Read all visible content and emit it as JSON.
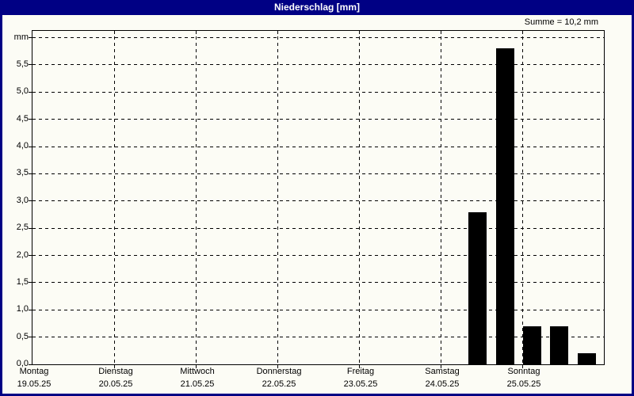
{
  "window": {
    "title": "Niederschlag [mm]"
  },
  "summary_label": "Summe = 10,2 mm",
  "colors": {
    "titlebar_bg": "#000084",
    "titlebar_text": "#FFFFFF",
    "window_border": "#000084",
    "background": "#FCFCF5",
    "bar": "#000000",
    "grid": "#000000",
    "text": "#000000"
  },
  "chart_data": {
    "type": "bar",
    "title": "Niederschlag [mm]",
    "ylabel_unit": "mm",
    "top_axis_label": "mm",
    "ylim": [
      0,
      6.125
    ],
    "ytick_step": 0.5,
    "ytick_labels": [
      "0,0",
      "0,5",
      "1,0",
      "1,5",
      "2,0",
      "2,5",
      "3,0",
      "3,5",
      "4,0",
      "4,5",
      "5,0",
      "5,5"
    ],
    "grid": "dashed",
    "sum_text": "Summe = 10,2 mm",
    "sum_value_mm": 10.2,
    "slots_per_day": 3,
    "categories": [
      {
        "day": "Montag",
        "date": "19.05.25"
      },
      {
        "day": "Dienstag",
        "date": "20.05.25"
      },
      {
        "day": "Mittwoch",
        "date": "21.05.25"
      },
      {
        "day": "Donnerstag",
        "date": "22.05.25"
      },
      {
        "day": "Freitag",
        "date": "23.05.25"
      },
      {
        "day": "Samstag",
        "date": "24.05.25"
      },
      {
        "day": "Sonntag",
        "date": "25.05.25"
      }
    ],
    "bars": [
      {
        "day_index": 5,
        "slot": 1,
        "value": 2.8
      },
      {
        "day_index": 5,
        "slot": 2,
        "value": 5.8
      },
      {
        "day_index": 6,
        "slot": 0,
        "value": 0.7
      },
      {
        "day_index": 6,
        "slot": 1,
        "value": 0.7
      },
      {
        "day_index": 6,
        "slot": 2,
        "value": 0.2
      }
    ]
  }
}
